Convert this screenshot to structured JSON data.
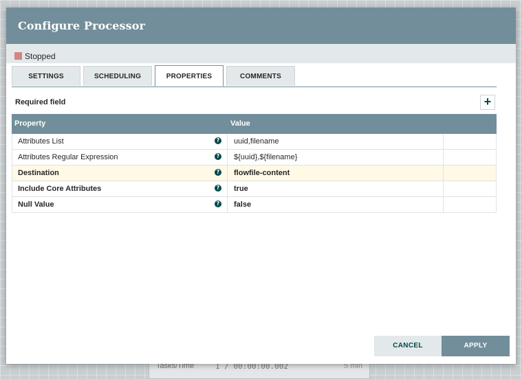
{
  "background": {
    "card_label": "Tasks/Time",
    "card_value": "1 / 00:00:00.002",
    "card_right": "5 min"
  },
  "dialog": {
    "title": "Configure Processor",
    "status": {
      "label": "Stopped",
      "color": "#d18686"
    },
    "tabs": [
      {
        "label": "SETTINGS",
        "active": false
      },
      {
        "label": "SCHEDULING",
        "active": false
      },
      {
        "label": "PROPERTIES",
        "active": true
      },
      {
        "label": "COMMENTS",
        "active": false
      }
    ],
    "required_field_label": "Required field",
    "add_property_icon": "plus-icon",
    "grid": {
      "columns": [
        "Property",
        "Value"
      ],
      "rows": [
        {
          "property": "Attributes List",
          "value": "uuid,filename",
          "required": false
        },
        {
          "property": "Attributes Regular Expression",
          "value": "${uuid},${filename}",
          "required": false
        },
        {
          "property": "Destination",
          "value": "flowfile-content",
          "required": true
        },
        {
          "property": "Include Core Attributes",
          "value": "true",
          "required": true
        },
        {
          "property": "Null Value",
          "value": "false",
          "required": true
        }
      ]
    },
    "buttons": {
      "cancel": "CANCEL",
      "apply": "APPLY"
    },
    "colors": {
      "header": "#728e9b",
      "accent": "#004849"
    }
  }
}
